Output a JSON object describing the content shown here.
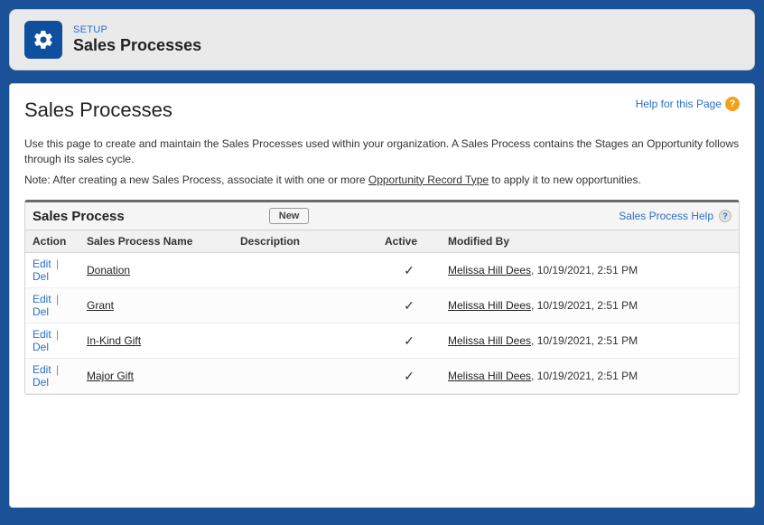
{
  "header": {
    "eyebrow": "SETUP",
    "title": "Sales Processes"
  },
  "page": {
    "title": "Sales Processes",
    "help_label": "Help for this Page",
    "intro1": "Use this page to create and maintain the Sales Processes used within your organization. A Sales Process contains the Stages an Opportunity follows through its sales cycle.",
    "note_prefix": "Note: After creating a new Sales Process, associate it with one or more ",
    "note_link": "Opportunity Record Type",
    "note_suffix": " to apply it to new opportunities."
  },
  "panel": {
    "title": "Sales Process",
    "new_label": "New",
    "help_label": "Sales Process Help"
  },
  "columns": {
    "action": "Action",
    "name": "Sales Process Name",
    "description": "Description",
    "active": "Active",
    "modified_by": "Modified By"
  },
  "action_labels": {
    "edit": "Edit",
    "del": "Del"
  },
  "rows": [
    {
      "name": "Donation",
      "description": "",
      "active": true,
      "modified_by_user": "Melissa Hill Dees",
      "modified_at": "10/19/2021, 2:51 PM"
    },
    {
      "name": "Grant",
      "description": "",
      "active": true,
      "modified_by_user": "Melissa Hill Dees",
      "modified_at": "10/19/2021, 2:51 PM"
    },
    {
      "name": "In-Kind Gift",
      "description": "",
      "active": true,
      "modified_by_user": "Melissa Hill Dees",
      "modified_at": "10/19/2021, 2:51 PM"
    },
    {
      "name": "Major Gift",
      "description": "",
      "active": true,
      "modified_by_user": "Melissa Hill Dees",
      "modified_at": "10/19/2021, 2:51 PM"
    }
  ]
}
